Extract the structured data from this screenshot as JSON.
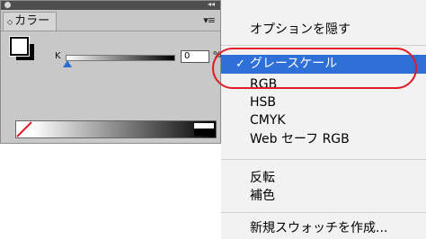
{
  "panel": {
    "tab_label": "カラー",
    "tab_arrows": "◇",
    "collapse_label": "◂◂",
    "menu_label": "▾≡",
    "k_label": "K",
    "k_value": "0",
    "percent_label": "%",
    "slider_level": 0
  },
  "menu": {
    "items": [
      {
        "label": "オプションを隠す",
        "selected": false
      },
      {
        "label": "グレースケール",
        "selected": true,
        "check": "✓"
      },
      {
        "label": "RGB",
        "selected": false
      },
      {
        "label": "HSB",
        "selected": false
      },
      {
        "label": "CMYK",
        "selected": false
      },
      {
        "label": "Web セーフ RGB",
        "selected": false
      },
      {
        "label": "反転",
        "selected": false
      },
      {
        "label": "補色",
        "selected": false
      },
      {
        "label": "新規スウォッチを作成...",
        "selected": false
      }
    ]
  },
  "colors": {
    "selection": "#2f6fd8",
    "annotation": "#e11d2a",
    "panel_bg": "#c8c8c8",
    "slider_thumb": "#2a6fd4"
  }
}
